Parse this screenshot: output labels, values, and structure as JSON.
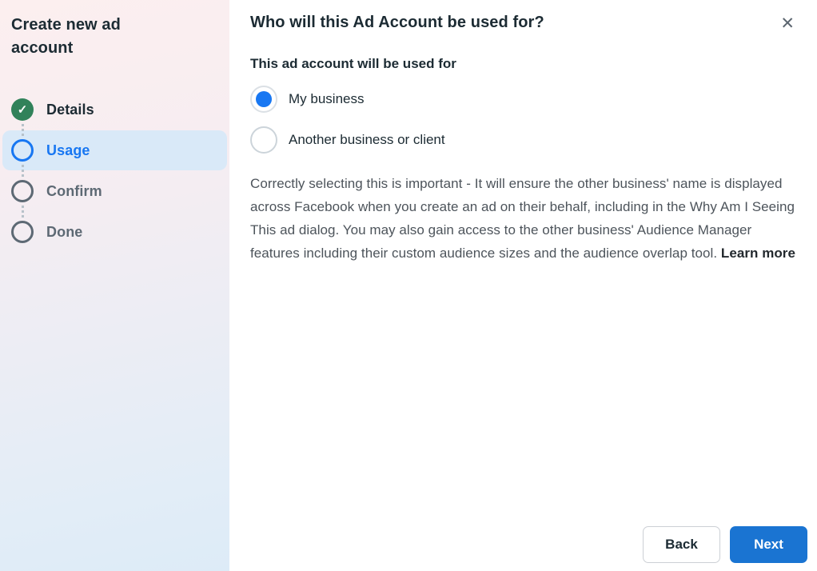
{
  "sidebar": {
    "title": "Create new ad account",
    "steps": [
      {
        "label": "Details",
        "state": "complete"
      },
      {
        "label": "Usage",
        "state": "active"
      },
      {
        "label": "Confirm",
        "state": "pending"
      },
      {
        "label": "Done",
        "state": "pending"
      }
    ]
  },
  "main": {
    "heading": "Who will this Ad Account be used for?",
    "question_label": "This ad account will be used for",
    "options": [
      {
        "label": "My business",
        "selected": true
      },
      {
        "label": "Another business or client",
        "selected": false
      }
    ],
    "description": "Correctly selecting this is important - It will ensure the other business' name is displayed across Facebook when you create an ad on their behalf, including in the Why Am I Seeing This ad dialog. You may also gain access to the other business' Audience Manager features including their custom audience sizes and the audience overlap tool.",
    "learn_more_label": "Learn more"
  },
  "footer": {
    "back_label": "Back",
    "next_label": "Next"
  },
  "icons": {
    "check": "✓",
    "close": "✕"
  },
  "colors": {
    "accent_blue": "#1877f2",
    "button_blue": "#1a74d2",
    "success_green": "#31825a",
    "active_step_background": "#d9e9f8",
    "pending_gray": "#5d6974",
    "text_dark": "#1c2b33",
    "text_gray": "#4d545b"
  }
}
